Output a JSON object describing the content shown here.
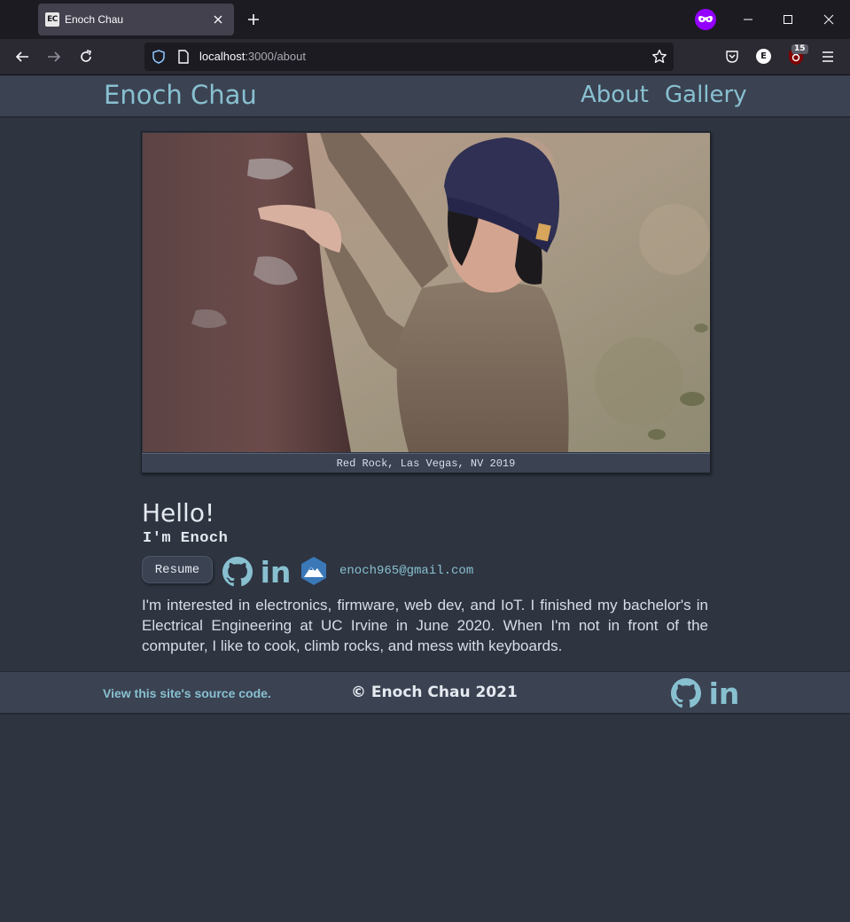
{
  "browser": {
    "tab_title": "Enoch Chau",
    "favicon_text": "EC",
    "url_host": "localhost",
    "url_path": ":3000/about",
    "ublock_count": "15",
    "extension_letter": "E"
  },
  "site": {
    "title": "Enoch Chau",
    "nav": [
      {
        "label": "About"
      },
      {
        "label": "Gallery"
      }
    ]
  },
  "photo": {
    "caption": "Red Rock, Las Vegas, NV 2019"
  },
  "intro": {
    "greeting": "Hello!",
    "subtitle": "I'm Enoch",
    "resume_label": "Resume",
    "email": "enoch965@gmail.com",
    "bio": "I'm interested in electronics, firmware, web dev, and IoT. I finished my bachelor's in Electrical Engineering at UC Irvine in June 2020. When I'm not in front of the computer, I like to cook, climb rocks, and mess with keyboards.",
    "linkedin_text": "in"
  },
  "footer": {
    "source_link": "View this site's source code.",
    "copyright": "© Enoch Chau 2021",
    "linkedin_text": "in"
  },
  "colors": {
    "background": "#2e3440",
    "panel": "#3b4252",
    "accent": "#88c0d0",
    "text": "#e5e9f0"
  }
}
